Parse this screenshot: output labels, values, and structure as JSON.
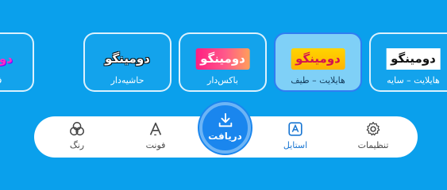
{
  "styles": [
    {
      "preview_text": "دومینگو",
      "label": "فانتزی",
      "variant": "fancy",
      "selected": false
    },
    {
      "preview_text": "دومینگو",
      "label": "حاشیه‌دار",
      "variant": "outline",
      "selected": false
    },
    {
      "preview_text": "دومینگو",
      "label": "باکس‌دار",
      "variant": "boxed",
      "selected": false
    },
    {
      "preview_text": "دومینگو",
      "label": "هایلایت – طیف",
      "variant": "highlight",
      "selected": true
    },
    {
      "preview_text": "دومینگو",
      "label": "هایلایت – سایه",
      "variant": "shadow",
      "selected": false
    }
  ],
  "nav": {
    "color": {
      "label": "رنگ",
      "icon": "palette-icon"
    },
    "font": {
      "label": "فونت",
      "icon": "font-icon"
    },
    "download": {
      "label": "دریافت",
      "icon": "download-icon"
    },
    "style": {
      "label": "استایل",
      "icon": "style-icon"
    },
    "settings": {
      "label": "تنظیمات",
      "icon": "gear-icon"
    }
  },
  "colors": {
    "background": "#0aa0ec",
    "accent": "#1a86ee",
    "selected_card": "#7fd0f7"
  }
}
